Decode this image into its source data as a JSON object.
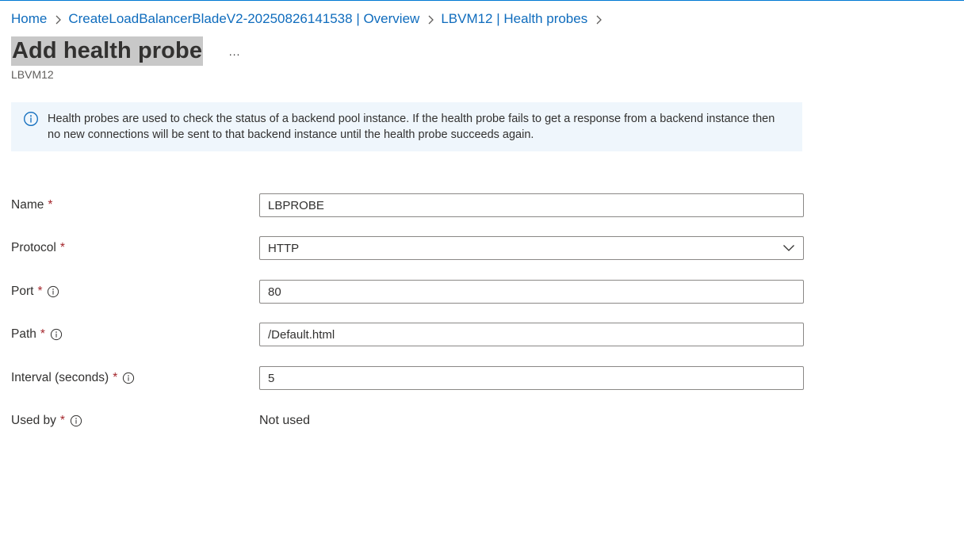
{
  "breadcrumb": {
    "items": [
      {
        "label": "Home"
      },
      {
        "label": "CreateLoadBalancerBladeV2-20250826141538 | Overview"
      },
      {
        "label": "LBVM12 | Health probes"
      }
    ]
  },
  "header": {
    "title": "Add health probe",
    "more_label": "...",
    "subtitle": "LBVM12"
  },
  "banner": {
    "text": "Health probes are used to check the status of a backend pool instance. If the health probe fails to get a response from a backend instance then no new connections will be sent to that backend instance until the health probe succeeds again."
  },
  "form": {
    "name": {
      "label": "Name",
      "required": "*",
      "value": "LBPROBE"
    },
    "protocol": {
      "label": "Protocol",
      "required": "*",
      "value": "HTTP"
    },
    "port": {
      "label": "Port",
      "required": "*",
      "value": "80"
    },
    "path": {
      "label": "Path",
      "required": "*",
      "value": "/Default.html"
    },
    "interval": {
      "label": "Interval (seconds)",
      "required": "*",
      "value": "5"
    },
    "used_by": {
      "label": "Used by",
      "required": "*",
      "value": "Not used"
    }
  },
  "icons": {
    "breadcrumb_separator": "chevron-right-icon",
    "banner": "info-icon",
    "field_info": "info-icon",
    "dropdown": "chevron-down-icon"
  },
  "colors": {
    "link": "#0f6cbd",
    "banner_bg": "#eff6fc",
    "required": "#a4262c",
    "title_highlight": "#c8c8c8"
  }
}
